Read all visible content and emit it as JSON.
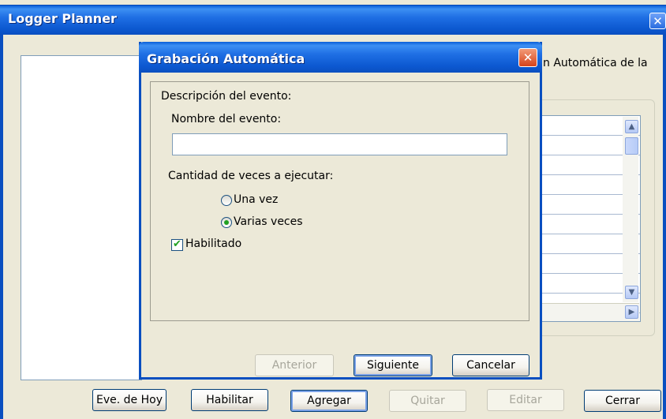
{
  "main_window": {
    "title": "Logger Planner",
    "close_glyph": "✕",
    "right_description": "n Automática de la",
    "buttons": {
      "today_events": "Eve. de Hoy",
      "enable": "Habilitar",
      "add": "Agregar",
      "remove": "Quitar",
      "edit": "Editar",
      "close": "Cerrar"
    },
    "scroll_glyphs": {
      "up": "▲",
      "down": "▼",
      "right": "▶"
    }
  },
  "dialog": {
    "title": "Grabación Automática",
    "close_glyph": "✕",
    "section_label": "Descripción del evento:",
    "name_label": "Nombre del evento:",
    "name_value": "",
    "count_label": "Cantidad de veces a ejecutar:",
    "options": [
      {
        "label": "Una vez",
        "selected": false
      },
      {
        "label": "Varias veces",
        "selected": true
      }
    ],
    "enabled_label": "Habilitado",
    "enabled_checked": true,
    "check_glyph": "✔",
    "buttons": {
      "previous": "Anterior",
      "next": "Siguiente",
      "cancel": "Cancelar"
    }
  },
  "colors": {
    "titlebar_blue": "#0a4fc0",
    "window_bg": "#ece9d8",
    "close_red": "#d6431b"
  }
}
